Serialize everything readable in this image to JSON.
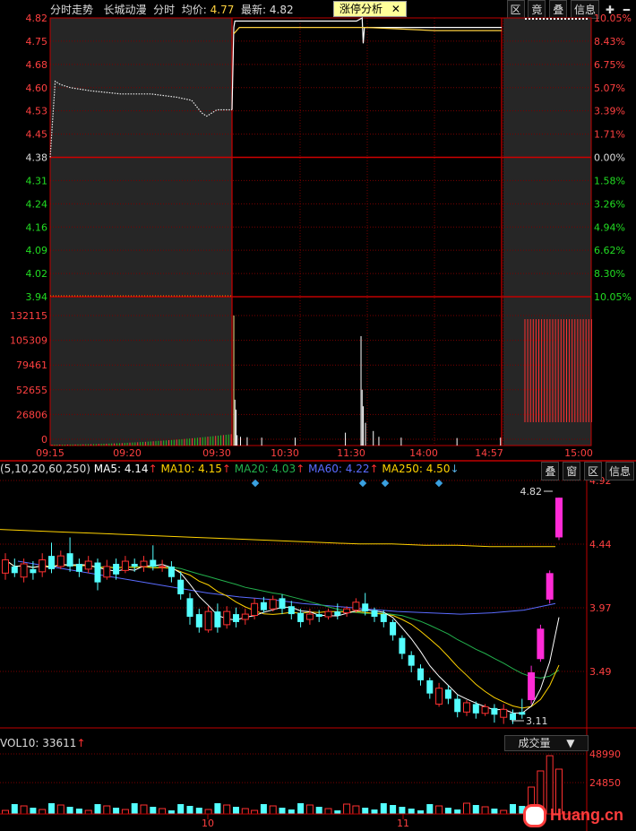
{
  "intraday": {
    "header": {
      "panel": "分时走势",
      "stock": "长城动漫",
      "mode": "分时",
      "avg_label": "均价:",
      "avg_value": "4.77",
      "last_label": "最新:",
      "last_value": "4.82",
      "analysis_button": "涨停分析",
      "buttons": [
        "区",
        "竟",
        "叠",
        "信息"
      ]
    }
  },
  "kline": {
    "header": {
      "params": "(5,10,20,60,250)",
      "ma5": "MA5: 4.14",
      "ma10": "MA10: 4.15",
      "ma20": "MA20: 4.03",
      "ma60": "MA60: 4.22",
      "ma250": "MA250: 4.50",
      "buttons": [
        "叠",
        "窗",
        "区",
        "信息"
      ]
    }
  },
  "volume": {
    "header": "VOL10: 33611",
    "dropdown": "成交量"
  },
  "watermark": "Huang.cn",
  "colors": {
    "price_line": "#ffffff",
    "avg_line": "#ffd23f",
    "up": "#ff3030",
    "down": "#54ffff",
    "grid": "#7a0000",
    "magenta": "#ff2bd6"
  },
  "chart_data": [
    {
      "type": "line",
      "name": "intraday",
      "x_ticks": [
        "09:15",
        "09:20",
        "09:30",
        "10:30",
        "11:30",
        "14:00",
        "14:57",
        "15:00"
      ],
      "price_ticks_left": [
        "4.82",
        "4.75",
        "4.68",
        "4.60",
        "4.53",
        "4.45",
        "4.38",
        "4.31",
        "4.24",
        "4.16",
        "4.09",
        "4.02",
        "3.94"
      ],
      "pct_ticks_right": [
        "10.05%",
        "8.43%",
        "6.75%",
        "5.07%",
        "3.39%",
        "1.71%",
        "0.00%",
        "1.58%",
        "3.26%",
        "4.94%",
        "6.62%",
        "8.30%",
        "10.05%"
      ],
      "ylim": [
        3.94,
        4.82
      ],
      "preclose": 4.38,
      "auction_price": [
        [
          0,
          4.38
        ],
        [
          1,
          4.62
        ],
        [
          2,
          4.61
        ],
        [
          4,
          4.6
        ],
        [
          8,
          4.59
        ],
        [
          14,
          4.58
        ],
        [
          20,
          4.58
        ],
        [
          25,
          4.57
        ],
        [
          28,
          4.56
        ],
        [
          30,
          4.52
        ],
        [
          31,
          4.51
        ],
        [
          33,
          4.53
        ],
        [
          36,
          4.53
        ]
      ],
      "session_price": [
        [
          0,
          4.79
        ],
        [
          1,
          4.81
        ],
        [
          3,
          4.81
        ],
        [
          10,
          4.81
        ],
        [
          20,
          4.81
        ],
        [
          60,
          4.81
        ],
        [
          110,
          4.81
        ],
        [
          115,
          4.82
        ],
        [
          116,
          4.74
        ],
        [
          117,
          4.79
        ],
        [
          118,
          4.79
        ],
        [
          150,
          4.79
        ],
        [
          180,
          4.79
        ],
        [
          240,
          4.79
        ]
      ],
      "session_avg": [
        [
          0,
          4.77
        ],
        [
          5,
          4.79
        ],
        [
          20,
          4.79
        ],
        [
          60,
          4.79
        ],
        [
          120,
          4.79
        ],
        [
          180,
          4.78
        ],
        [
          240,
          4.78
        ]
      ],
      "close_price": 4.82,
      "volume_ticks": [
        "132115",
        "105309",
        "79461",
        "52655",
        "26806",
        "0"
      ],
      "vol_ylim": [
        0,
        150000
      ],
      "volume_spikes": [
        [
          0,
          150000
        ],
        [
          1,
          48000
        ],
        [
          2,
          36000
        ],
        [
          3,
          5000
        ],
        [
          6,
          3000
        ],
        [
          12,
          2500
        ],
        [
          25,
          2000
        ],
        [
          55,
          2000
        ],
        [
          100,
          8000
        ],
        [
          114,
          125000
        ],
        [
          115,
          60000
        ],
        [
          116,
          40000
        ],
        [
          118,
          20000
        ],
        [
          125,
          10000
        ],
        [
          130,
          3000
        ],
        [
          150,
          2000
        ],
        [
          200,
          1500
        ],
        [
          239,
          2000
        ]
      ],
      "closing_auction_volume": 150000
    },
    {
      "type": "candlestick",
      "name": "daily kline",
      "y_ticks": [
        "4.92",
        "4.44",
        "3.97",
        "3.49"
      ],
      "ylim": [
        3.08,
        4.95
      ],
      "annotations": {
        "high_label": "4.82",
        "low_label": "3.11"
      },
      "x_ticks": [
        "10",
        "11"
      ],
      "candles": [
        [
          4.25,
          4.35,
          4.2,
          4.4
        ],
        [
          4.3,
          4.25,
          4.22,
          4.36
        ],
        [
          4.22,
          4.32,
          4.18,
          4.36
        ],
        [
          4.28,
          4.25,
          4.2,
          4.34
        ],
        [
          4.26,
          4.35,
          4.22,
          4.4
        ],
        [
          4.38,
          4.28,
          4.25,
          4.48
        ],
        [
          4.3,
          4.38,
          4.28,
          4.42
        ],
        [
          4.4,
          4.3,
          4.26,
          4.52
        ],
        [
          4.32,
          4.26,
          4.22,
          4.36
        ],
        [
          4.28,
          4.34,
          4.25,
          4.38
        ],
        [
          4.33,
          4.18,
          4.12,
          4.36
        ],
        [
          4.22,
          4.3,
          4.2,
          4.35
        ],
        [
          4.32,
          4.24,
          4.2,
          4.36
        ],
        [
          4.27,
          4.34,
          4.25,
          4.38
        ],
        [
          4.32,
          4.3,
          4.26,
          4.36
        ],
        [
          4.3,
          4.34,
          4.26,
          4.38
        ],
        [
          4.35,
          4.3,
          4.27,
          4.46
        ],
        [
          4.3,
          4.3,
          4.26,
          4.35
        ],
        [
          4.3,
          4.22,
          4.18,
          4.34
        ],
        [
          4.2,
          4.09,
          4.05,
          4.26
        ],
        [
          4.06,
          3.92,
          3.86,
          4.1
        ],
        [
          3.94,
          3.84,
          3.8,
          3.98
        ],
        [
          3.82,
          3.96,
          3.8,
          4.0
        ],
        [
          3.96,
          3.84,
          3.8,
          4.02
        ],
        [
          3.86,
          3.96,
          3.83,
          4.0
        ],
        [
          3.94,
          3.88,
          3.84,
          3.99
        ],
        [
          3.9,
          3.94,
          3.86,
          3.98
        ],
        [
          3.93,
          4.02,
          3.9,
          4.06
        ],
        [
          4.03,
          3.97,
          3.95,
          4.07
        ],
        [
          3.98,
          4.05,
          3.96,
          4.08
        ],
        [
          4.06,
          3.98,
          3.94,
          4.09
        ],
        [
          4.0,
          3.94,
          3.9,
          4.04
        ],
        [
          3.95,
          3.88,
          3.84,
          3.98
        ],
        [
          3.9,
          3.94,
          3.86,
          3.98
        ],
        [
          3.94,
          3.92,
          3.88,
          3.97
        ],
        [
          3.92,
          3.96,
          3.9,
          3.98
        ],
        [
          3.96,
          3.93,
          3.9,
          4.02
        ],
        [
          3.95,
          3.98,
          3.92,
          4.0
        ],
        [
          3.97,
          4.03,
          3.95,
          4.06
        ],
        [
          4.02,
          3.96,
          3.93,
          4.1
        ],
        [
          3.97,
          3.92,
          3.88,
          3.99
        ],
        [
          3.94,
          3.88,
          3.84,
          3.97
        ],
        [
          3.88,
          3.78,
          3.74,
          3.9
        ],
        [
          3.76,
          3.64,
          3.6,
          3.78
        ],
        [
          3.63,
          3.55,
          3.5,
          3.66
        ],
        [
          3.53,
          3.44,
          3.4,
          3.56
        ],
        [
          3.44,
          3.34,
          3.3,
          3.46
        ],
        [
          3.26,
          3.38,
          3.24,
          3.42
        ],
        [
          3.37,
          3.3,
          3.26,
          3.4
        ],
        [
          3.3,
          3.2,
          3.16,
          3.33
        ],
        [
          3.2,
          3.27,
          3.17,
          3.29
        ],
        [
          3.26,
          3.19,
          3.15,
          3.28
        ],
        [
          3.19,
          3.24,
          3.17,
          3.26
        ],
        [
          3.23,
          3.18,
          3.12,
          3.26
        ],
        [
          3.16,
          3.22,
          3.11,
          3.26
        ],
        [
          3.19,
          3.14,
          3.11,
          3.22
        ],
        [
          3.2,
          3.18,
          3.15,
          3.3
        ],
        [
          3.29,
          3.5,
          3.26,
          3.55
        ],
        [
          3.6,
          3.83,
          3.58,
          3.86
        ],
        [
          4.05,
          4.25,
          4.02,
          4.27
        ],
        [
          4.52,
          4.82,
          4.5,
          4.82
        ]
      ],
      "ma_series": [
        {
          "name": "MA5",
          "color": "#ffffff"
        },
        {
          "name": "MA10",
          "color": "#ffd200"
        },
        {
          "name": "MA20",
          "color": "#23b14d"
        },
        {
          "name": "MA60",
          "color": "#5a6bff",
          "values": [
            4.34,
            4.3,
            4.26,
            4.22,
            4.18,
            4.14,
            4.1,
            4.07,
            4.05,
            4.02,
            4.0,
            3.98,
            3.96,
            3.95,
            3.94,
            3.95,
            3.97,
            4.02
          ]
        },
        {
          "name": "MA250",
          "color": "#ffd200",
          "values": [
            4.58,
            4.57,
            4.56,
            4.55,
            4.54,
            4.53,
            4.52,
            4.51,
            4.5,
            4.49,
            4.48,
            4.47,
            4.47,
            4.46,
            4.46,
            4.45,
            4.45,
            4.45
          ]
        }
      ],
      "ma_param_text": "(5,10,20,60,250)"
    },
    {
      "type": "bar",
      "name": "volume",
      "y_ticks": [
        "48990",
        "24850"
      ],
      "ylim": [
        0,
        55000
      ]
    }
  ]
}
